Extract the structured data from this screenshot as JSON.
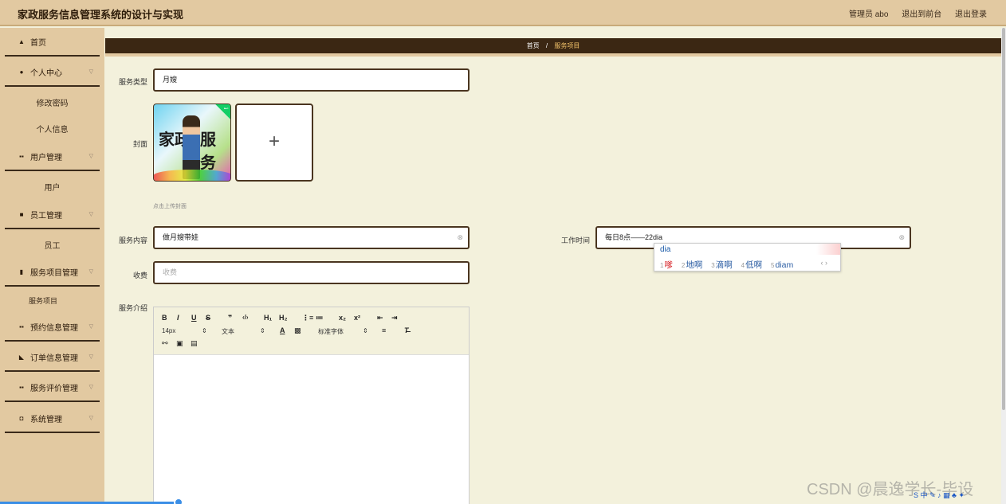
{
  "header": {
    "title": "家政服务信息管理系统的设计与实现",
    "user": "管理员 abo",
    "to_front": "退出到前台",
    "logout": "退出登录"
  },
  "sidebar": {
    "home": "首页",
    "personal": "个人中心",
    "change_pwd": "修改密码",
    "personal_info": "个人信息",
    "user_mgmt": "用户管理",
    "user": "用户",
    "staff_mgmt": "员工管理",
    "staff": "员工",
    "service_item_mgmt": "服务项目管理",
    "service_item": "服务项目",
    "booking_mgmt": "预约信息管理",
    "order_mgmt": "订单信息管理",
    "review_mgmt": "服务评价管理",
    "system_mgmt": "系统管理"
  },
  "breadcrumb": {
    "home": "首页",
    "sep": "/",
    "current": "服务项目"
  },
  "form": {
    "service_type_label": "服务类型",
    "service_type_value": "月嫂",
    "cover_label": "封面",
    "cover_image_text_left": "家政",
    "cover_image_text_right": "服务",
    "cover_hint": "点击上传封面",
    "content_label": "服务内容",
    "content_value": "做月嫂带娃",
    "worktime_label": "工作时间",
    "worktime_value": "每日8点——22dia",
    "fee_label": "收费",
    "fee_placeholder": "收费",
    "intro_label": "服务介绍"
  },
  "editor": {
    "font_size": "14px",
    "text_style": "文本",
    "font_family": "标准字体"
  },
  "ime": {
    "typed": "dia",
    "candidates": [
      {
        "n": "1",
        "w": "嗲"
      },
      {
        "n": "2",
        "w": "地啊"
      },
      {
        "n": "3",
        "w": "滴啊"
      },
      {
        "n": "4",
        "w": "低啊"
      },
      {
        "n": "5",
        "w": "diam"
      }
    ]
  },
  "watermark": "CSDN @晨逸学长-毕设"
}
